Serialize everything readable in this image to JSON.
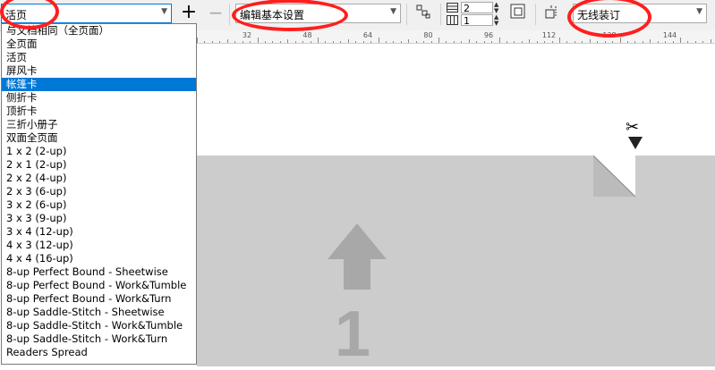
{
  "toolbar": {
    "layout_select_value": "活页",
    "preset_select_value": "编辑基本设置",
    "rows_value": "2",
    "cols_value": "1",
    "binding_select_value": "无线装订",
    "add_icon": "plus-icon",
    "remove_icon": "minus-icon"
  },
  "ruler": {
    "labels": [
      "32",
      "48",
      "64",
      "80",
      "96",
      "112",
      "128",
      "144"
    ]
  },
  "dropdown": {
    "selected_index": 4,
    "options": [
      "与文档相同（全页面）",
      "全页面",
      "活页",
      "屏风卡",
      "帐篷卡",
      "侧折卡",
      "顶折卡",
      "三折小册子",
      "双面全页面",
      "1 x 2 (2-up)",
      "2 x 1 (2-up)",
      "2 x 2 (4-up)",
      "2 x 3 (6-up)",
      "3 x 2 (6-up)",
      "3 x 3 (9-up)",
      "3 x 4 (12-up)",
      "4 x 3 (12-up)",
      "4 x 4 (16-up)",
      "8-up Perfect Bound - Sheetwise",
      "8-up Perfect Bound - Work&Tumble",
      "8-up Perfect Bound - Work&Turn",
      "8-up Saddle-Stitch - Sheetwise",
      "8-up Saddle-Stitch - Work&Tumble",
      "8-up Saddle-Stitch - Work&Turn",
      "Readers Spread"
    ]
  },
  "canvas": {
    "page_number": "1",
    "cut_icon": "scissors-icon"
  },
  "colors": {
    "highlight": "#0078d7",
    "annotation": "#ff1e1e",
    "page": "#cccccc"
  }
}
